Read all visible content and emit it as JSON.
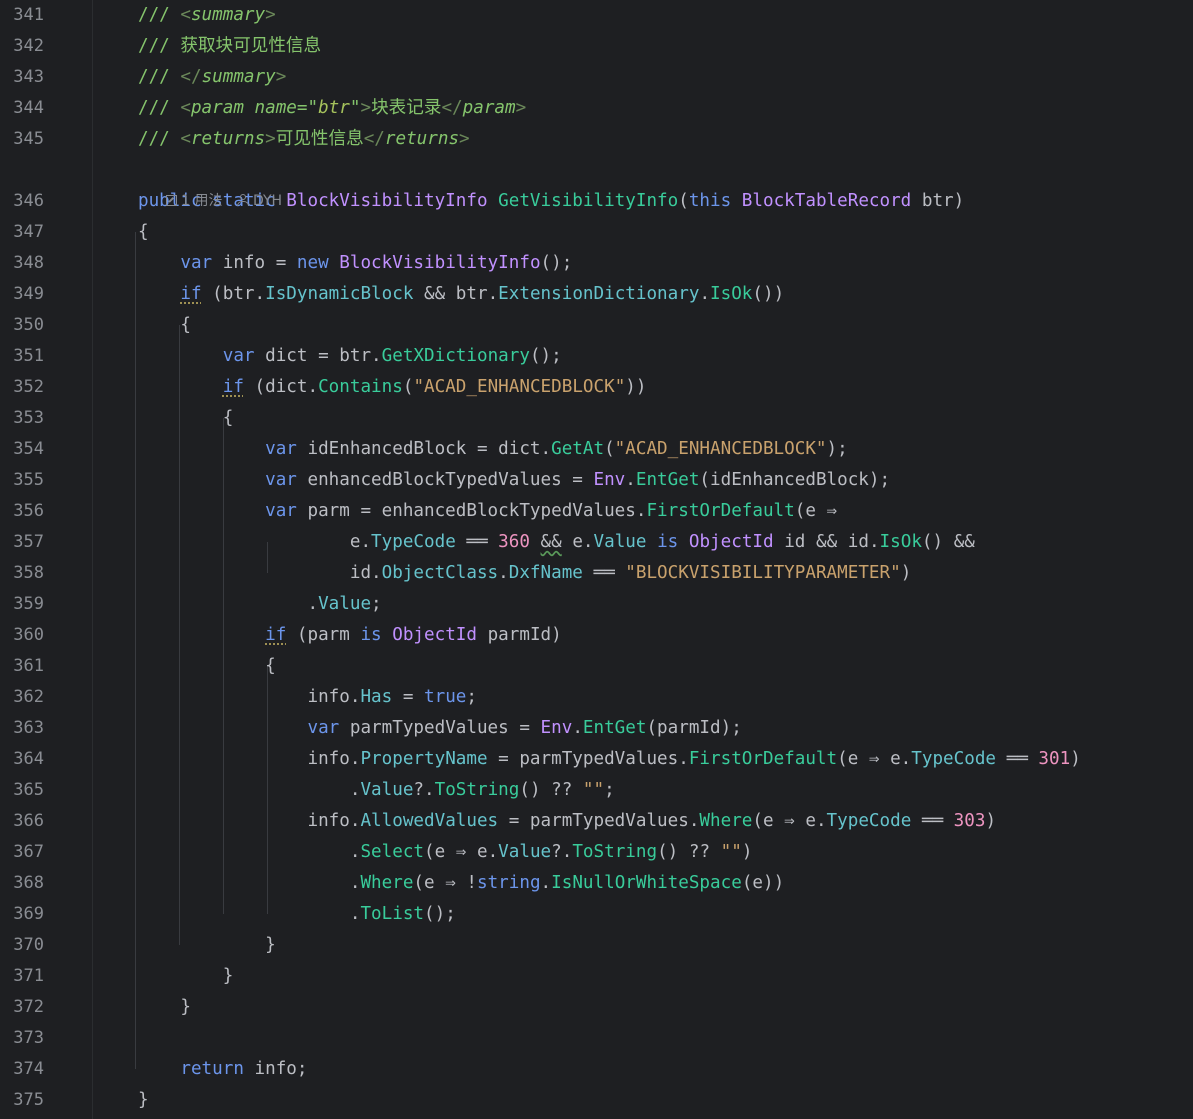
{
  "editor": {
    "hint": {
      "icon": "usages-icon",
      "usages": "1 用法",
      "author_icon": "user-icon",
      "author": "DYH"
    },
    "lines": [
      {
        "n": "341",
        "tokens": [
          [
            "cm",
            "/// "
          ],
          [
            "tg",
            "<"
          ],
          [
            "tgn",
            "summary"
          ],
          [
            "tg",
            ">"
          ]
        ]
      },
      {
        "n": "342",
        "tokens": [
          [
            "cm",
            "/// 获取块可见性信息"
          ]
        ]
      },
      {
        "n": "343",
        "tokens": [
          [
            "cm",
            "/// "
          ],
          [
            "tg",
            "</"
          ],
          [
            "tgn",
            "summary"
          ],
          [
            "tg",
            ">"
          ]
        ]
      },
      {
        "n": "344",
        "tokens": [
          [
            "cm",
            "/// "
          ],
          [
            "tg",
            "<"
          ],
          [
            "tgn",
            "param "
          ],
          [
            "at",
            "name"
          ],
          [
            "cm",
            "=\""
          ],
          [
            "av",
            "btr"
          ],
          [
            "cm",
            "\""
          ],
          [
            "tg",
            ">"
          ],
          [
            "cm",
            "块表记录"
          ],
          [
            "tg",
            "</"
          ],
          [
            "tgn",
            "param"
          ],
          [
            "tg",
            ">"
          ]
        ]
      },
      {
        "n": "345",
        "tokens": [
          [
            "cm",
            "/// "
          ],
          [
            "tg",
            "<"
          ],
          [
            "tgn",
            "returns"
          ],
          [
            "tg",
            ">"
          ],
          [
            "cm",
            "可见性信息"
          ],
          [
            "tg",
            "</"
          ],
          [
            "tgn",
            "returns"
          ],
          [
            "tg",
            ">"
          ]
        ]
      },
      {
        "n": "346",
        "tokens": [
          [
            "kw",
            "public static "
          ],
          [
            "ty",
            "BlockVisibilityInfo "
          ],
          [
            "me",
            "GetVisibilityInfo"
          ],
          [
            "op",
            "("
          ],
          [
            "kw",
            "this "
          ],
          [
            "ty",
            "BlockTableRecord "
          ],
          [
            "op",
            "btr)"
          ]
        ]
      },
      {
        "n": "347",
        "tokens": [
          [
            "op",
            "{"
          ]
        ]
      },
      {
        "n": "348",
        "tokens": [
          [
            "op",
            "    "
          ],
          [
            "kw",
            "var "
          ],
          [
            "op",
            "info = "
          ],
          [
            "kw",
            "new "
          ],
          [
            "ty",
            "BlockVisibilityInfo"
          ],
          [
            "op",
            "();"
          ]
        ]
      },
      {
        "n": "349",
        "tokens": [
          [
            "op",
            "    "
          ],
          [
            "kw sq",
            "if"
          ],
          [
            "op",
            " (btr."
          ],
          [
            "pr",
            "IsDynamicBlock"
          ],
          [
            "op",
            " && btr."
          ],
          [
            "pr",
            "ExtensionDictionary"
          ],
          [
            "op",
            "."
          ],
          [
            "me",
            "IsOk"
          ],
          [
            "op",
            "())"
          ]
        ]
      },
      {
        "n": "350",
        "tokens": [
          [
            "op",
            "    {"
          ]
        ]
      },
      {
        "n": "351",
        "tokens": [
          [
            "op",
            "        "
          ],
          [
            "kw",
            "var "
          ],
          [
            "op",
            "dict = btr."
          ],
          [
            "me",
            "GetXDictionary"
          ],
          [
            "op",
            "();"
          ]
        ]
      },
      {
        "n": "352",
        "tokens": [
          [
            "op",
            "        "
          ],
          [
            "kw sq",
            "if"
          ],
          [
            "op",
            " (dict."
          ],
          [
            "me",
            "Contains"
          ],
          [
            "op",
            "("
          ],
          [
            "st",
            "\"ACAD_ENHANCEDBLOCK\""
          ],
          [
            "op",
            "))"
          ]
        ]
      },
      {
        "n": "353",
        "tokens": [
          [
            "op",
            "        {"
          ]
        ]
      },
      {
        "n": "354",
        "tokens": [
          [
            "op",
            "            "
          ],
          [
            "kw",
            "var "
          ],
          [
            "op",
            "idEnhancedBlock = dict."
          ],
          [
            "me",
            "GetAt"
          ],
          [
            "op",
            "("
          ],
          [
            "st",
            "\"ACAD_ENHANCEDBLOCK\""
          ],
          [
            "op",
            ");"
          ]
        ]
      },
      {
        "n": "355",
        "tokens": [
          [
            "op",
            "            "
          ],
          [
            "kw",
            "var "
          ],
          [
            "op",
            "enhancedBlockTypedValues = "
          ],
          [
            "ty",
            "Env"
          ],
          [
            "op",
            "."
          ],
          [
            "me",
            "EntGet"
          ],
          [
            "op",
            "(idEnhancedBlock);"
          ]
        ]
      },
      {
        "n": "356",
        "tokens": [
          [
            "op",
            "            "
          ],
          [
            "kw",
            "var "
          ],
          [
            "op",
            "parm = enhancedBlockTypedValues."
          ],
          [
            "me",
            "FirstOrDefault"
          ],
          [
            "op",
            "(e ⇒"
          ]
        ]
      },
      {
        "n": "357",
        "tokens": [
          [
            "op",
            "                    e."
          ],
          [
            "pr",
            "TypeCode"
          ],
          [
            "op",
            " ══ "
          ],
          [
            "nu",
            "360"
          ],
          [
            "op",
            " "
          ],
          [
            "op sqg",
            "&&"
          ],
          [
            "op",
            " e."
          ],
          [
            "pr",
            "Value"
          ],
          [
            "op",
            " "
          ],
          [
            "kw",
            "is "
          ],
          [
            "ty",
            "ObjectId"
          ],
          [
            "op",
            " id && id."
          ],
          [
            "me",
            "IsOk"
          ],
          [
            "op",
            "() &&"
          ]
        ]
      },
      {
        "n": "358",
        "tokens": [
          [
            "op",
            "                    id."
          ],
          [
            "pr",
            "ObjectClass"
          ],
          [
            "op",
            "."
          ],
          [
            "pr",
            "DxfName"
          ],
          [
            "op",
            " ══ "
          ],
          [
            "st",
            "\"BLOCKVISIBILITYPARAMETER\""
          ],
          [
            "op",
            ")"
          ]
        ]
      },
      {
        "n": "359",
        "tokens": [
          [
            "op",
            "                ."
          ],
          [
            "pr",
            "Value"
          ],
          [
            "op",
            ";"
          ]
        ]
      },
      {
        "n": "360",
        "tokens": [
          [
            "op",
            "            "
          ],
          [
            "kw sq",
            "if"
          ],
          [
            "op",
            " (parm "
          ],
          [
            "kw",
            "is "
          ],
          [
            "ty",
            "ObjectId"
          ],
          [
            "op",
            " parmId)"
          ]
        ]
      },
      {
        "n": "361",
        "tokens": [
          [
            "op",
            "            {"
          ]
        ]
      },
      {
        "n": "362",
        "tokens": [
          [
            "op",
            "                info."
          ],
          [
            "pr",
            "Has"
          ],
          [
            "op",
            " = "
          ],
          [
            "kw",
            "true"
          ],
          [
            "op",
            ";"
          ]
        ]
      },
      {
        "n": "363",
        "tokens": [
          [
            "op",
            "                "
          ],
          [
            "kw",
            "var "
          ],
          [
            "op",
            "parmTypedValues = "
          ],
          [
            "ty",
            "Env"
          ],
          [
            "op",
            "."
          ],
          [
            "me",
            "EntGet"
          ],
          [
            "op",
            "(parmId);"
          ]
        ]
      },
      {
        "n": "364",
        "tokens": [
          [
            "op",
            "                info."
          ],
          [
            "pr",
            "PropertyName"
          ],
          [
            "op",
            " = parmTypedValues."
          ],
          [
            "me",
            "FirstOrDefault"
          ],
          [
            "op",
            "(e ⇒ e."
          ],
          [
            "pr",
            "TypeCode"
          ],
          [
            "op",
            " ══ "
          ],
          [
            "nu",
            "301"
          ],
          [
            "op",
            ")"
          ]
        ]
      },
      {
        "n": "365",
        "tokens": [
          [
            "op",
            "                    ."
          ],
          [
            "pr",
            "Value"
          ],
          [
            "op",
            "?."
          ],
          [
            "me",
            "ToString"
          ],
          [
            "op",
            "() ?? "
          ],
          [
            "st",
            "\"\""
          ],
          [
            "op",
            ";"
          ]
        ]
      },
      {
        "n": "366",
        "tokens": [
          [
            "op",
            "                info."
          ],
          [
            "pr",
            "AllowedValues"
          ],
          [
            "op",
            " = parmTypedValues."
          ],
          [
            "me",
            "Where"
          ],
          [
            "op",
            "(e ⇒ e."
          ],
          [
            "pr",
            "TypeCode"
          ],
          [
            "op",
            " ══ "
          ],
          [
            "nu",
            "303"
          ],
          [
            "op",
            ")"
          ]
        ]
      },
      {
        "n": "367",
        "tokens": [
          [
            "op",
            "                    ."
          ],
          [
            "me",
            "Select"
          ],
          [
            "op",
            "(e ⇒ e."
          ],
          [
            "pr",
            "Value"
          ],
          [
            "op",
            "?."
          ],
          [
            "me",
            "ToString"
          ],
          [
            "op",
            "() ?? "
          ],
          [
            "st",
            "\"\""
          ],
          [
            "op",
            ")"
          ]
        ]
      },
      {
        "n": "368",
        "tokens": [
          [
            "op",
            "                    ."
          ],
          [
            "me",
            "Where"
          ],
          [
            "op",
            "(e ⇒ !"
          ],
          [
            "kw",
            "string"
          ],
          [
            "op",
            "."
          ],
          [
            "me",
            "IsNullOrWhiteSpace"
          ],
          [
            "op",
            "(e))"
          ]
        ]
      },
      {
        "n": "369",
        "tokens": [
          [
            "op",
            "                    ."
          ],
          [
            "me",
            "ToList"
          ],
          [
            "op",
            "();"
          ]
        ]
      },
      {
        "n": "370",
        "tokens": [
          [
            "op",
            "            }"
          ]
        ]
      },
      {
        "n": "371",
        "tokens": [
          [
            "op",
            "        }"
          ]
        ]
      },
      {
        "n": "372",
        "tokens": [
          [
            "op",
            "    }"
          ]
        ]
      },
      {
        "n": "373",
        "tokens": []
      },
      {
        "n": "374",
        "tokens": [
          [
            "op",
            "    "
          ],
          [
            "kw",
            "return "
          ],
          [
            "op",
            "info;"
          ]
        ]
      },
      {
        "n": "375",
        "tokens": [
          [
            "op",
            "}"
          ]
        ]
      }
    ]
  }
}
